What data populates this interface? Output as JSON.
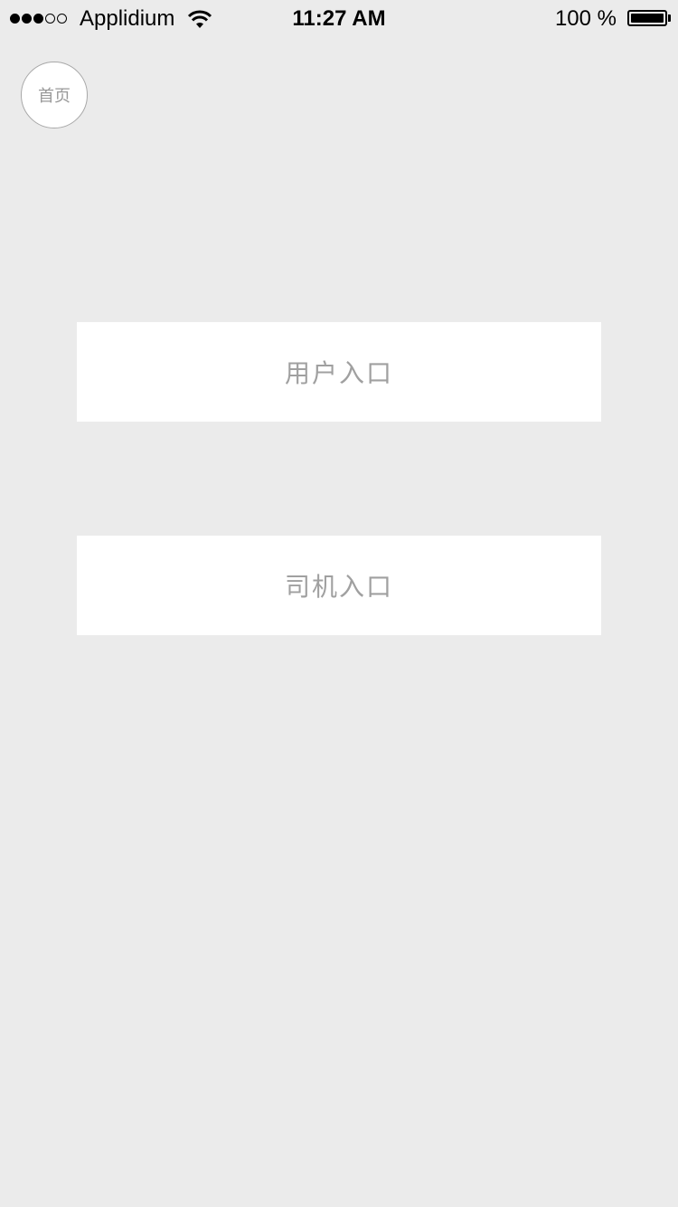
{
  "status_bar": {
    "carrier": "Applidium",
    "time": "11:27 AM",
    "battery": "100 %",
    "signal_icon": "signal-dots-icon",
    "wifi_icon": "wifi-icon",
    "battery_icon": "battery-icon"
  },
  "nav": {
    "home_label": "首页"
  },
  "entries": {
    "user_label": "用户入口",
    "driver_label": "司机入口"
  },
  "colors": {
    "background": "#ebebeb",
    "button_bg": "#ffffff",
    "button_text": "#a0a0a0"
  }
}
